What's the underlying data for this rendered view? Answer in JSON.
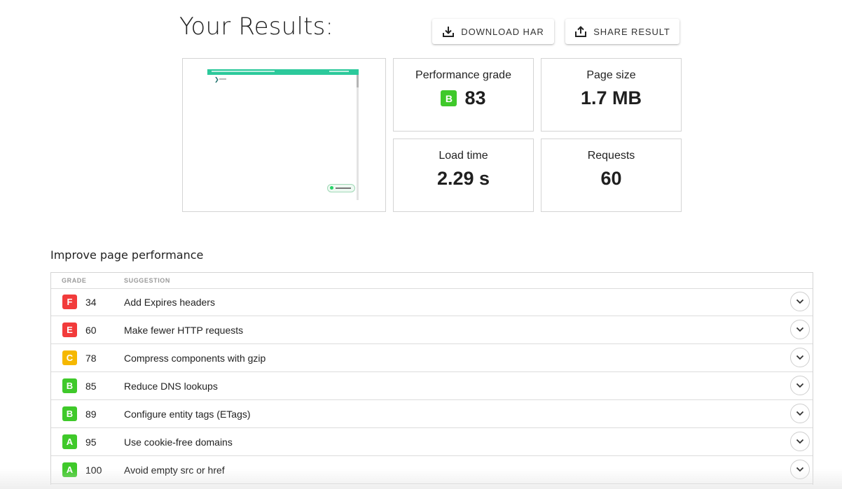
{
  "header": {
    "title": "Your Results:",
    "download_har_label": "DOWNLOAD HAR",
    "share_result_label": "SHARE RESULT"
  },
  "metrics": {
    "performance": {
      "label": "Performance grade",
      "grade": "B",
      "grade_color": "#3fc92a",
      "value": "83"
    },
    "page_size": {
      "label": "Page size",
      "value": "1.7 MB"
    },
    "load_time": {
      "label": "Load time",
      "value": "2.29 s"
    },
    "requests": {
      "label": "Requests",
      "value": "60"
    }
  },
  "improve": {
    "title": "Improve page performance",
    "columns": {
      "grade": "GRADE",
      "suggestion": "SUGGESTION"
    },
    "rows": [
      {
        "grade": "F",
        "score": "34",
        "suggestion": "Add Expires headers",
        "color": "#f23b3b"
      },
      {
        "grade": "E",
        "score": "60",
        "suggestion": "Make fewer HTTP requests",
        "color": "#f23b3b"
      },
      {
        "grade": "C",
        "score": "78",
        "suggestion": "Compress components with gzip",
        "color": "#f5b800"
      },
      {
        "grade": "B",
        "score": "85",
        "suggestion": "Reduce DNS lookups",
        "color": "#3fc92a"
      },
      {
        "grade": "B",
        "score": "89",
        "suggestion": "Configure entity tags (ETags)",
        "color": "#3fc92a"
      },
      {
        "grade": "A",
        "score": "95",
        "suggestion": "Use cookie-free domains",
        "color": "#3fc92a"
      },
      {
        "grade": "A",
        "score": "100",
        "suggestion": "Avoid empty src or href",
        "color": "#3fc92a"
      }
    ]
  },
  "icons": {
    "download": "download-icon",
    "share": "share-icon",
    "expand": "chevron-down-icon"
  }
}
